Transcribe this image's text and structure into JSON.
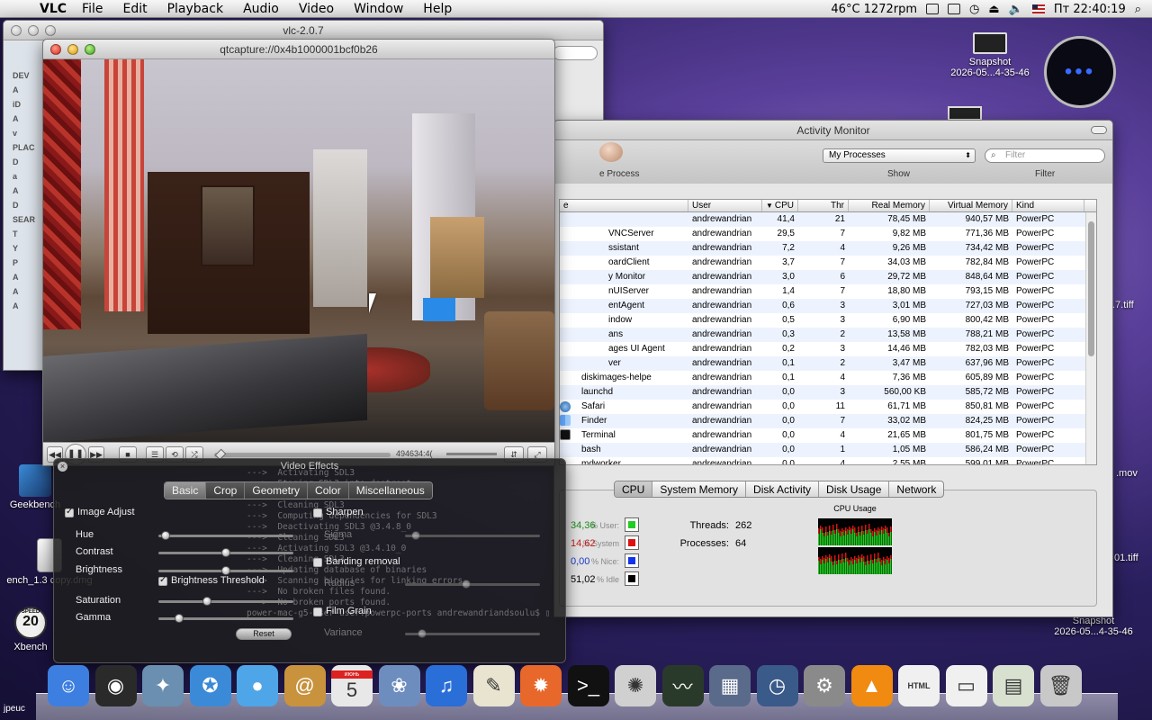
{
  "menubar": {
    "app": "VLC",
    "items": [
      "File",
      "Edit",
      "Playback",
      "Audio",
      "Video",
      "Window",
      "Help"
    ],
    "sensor": "46°C 1272rpm",
    "clock": "Пт 22:40:19"
  },
  "finder": {
    "title": "vlc-2.0.7",
    "sidebar": [
      "DEV",
      "A",
      "iD",
      "A",
      "v",
      "PLAC",
      "D",
      "a",
      "A",
      "D",
      "SEAR",
      "T",
      "Y",
      "P",
      "A",
      "A",
      "A"
    ]
  },
  "vlc": {
    "title": "qtcapture://0x4b1000001bcf0b26",
    "time": "494634:4("
  },
  "activity_monitor": {
    "title": "Activity Monitor",
    "process_label": "e Process",
    "filter_select": "My Processes",
    "search_placeholder": "Filter",
    "show_label": "Show",
    "filter_label": "Filter",
    "columns": [
      "e",
      "User",
      "CPU",
      "Thr",
      "Real Memory",
      "Virtual Memory",
      "Kind"
    ],
    "rows": [
      {
        "name": "",
        "user": "andrewandrian",
        "cpu": "41,4",
        "thr": "21",
        "rm": "78,45 MB",
        "vm": "940,57 MB",
        "kind": "PowerPC"
      },
      {
        "name": "VNCServer",
        "user": "andrewandrian",
        "cpu": "29,5",
        "thr": "7",
        "rm": "9,82 MB",
        "vm": "771,36 MB",
        "kind": "PowerPC"
      },
      {
        "name": "ssistant",
        "user": "andrewandrian",
        "cpu": "7,2",
        "thr": "4",
        "rm": "9,26 MB",
        "vm": "734,42 MB",
        "kind": "PowerPC"
      },
      {
        "name": "oardClient",
        "user": "andrewandrian",
        "cpu": "3,7",
        "thr": "7",
        "rm": "34,03 MB",
        "vm": "782,84 MB",
        "kind": "PowerPC"
      },
      {
        "name": "y Monitor",
        "user": "andrewandrian",
        "cpu": "3,0",
        "thr": "6",
        "rm": "29,72 MB",
        "vm": "848,64 MB",
        "kind": "PowerPC"
      },
      {
        "name": "nUIServer",
        "user": "andrewandrian",
        "cpu": "1,4",
        "thr": "7",
        "rm": "18,80 MB",
        "vm": "793,15 MB",
        "kind": "PowerPC"
      },
      {
        "name": "entAgent",
        "user": "andrewandrian",
        "cpu": "0,6",
        "thr": "3",
        "rm": "3,01 MB",
        "vm": "727,03 MB",
        "kind": "PowerPC"
      },
      {
        "name": "indow",
        "user": "andrewandrian",
        "cpu": "0,5",
        "thr": "3",
        "rm": "6,90 MB",
        "vm": "800,42 MB",
        "kind": "PowerPC"
      },
      {
        "name": "ans",
        "user": "andrewandrian",
        "cpu": "0,3",
        "thr": "2",
        "rm": "13,58 MB",
        "vm": "788,21 MB",
        "kind": "PowerPC"
      },
      {
        "name": "ages UI Agent",
        "user": "andrewandrian",
        "cpu": "0,2",
        "thr": "3",
        "rm": "14,46 MB",
        "vm": "782,03 MB",
        "kind": "PowerPC"
      },
      {
        "name": "ver",
        "user": "andrewandrian",
        "cpu": "0,1",
        "thr": "2",
        "rm": "3,47 MB",
        "vm": "637,96 MB",
        "kind": "PowerPC"
      },
      {
        "name": "diskimages-helpe",
        "user": "andrewandrian",
        "cpu": "0,1",
        "thr": "4",
        "rm": "7,36 MB",
        "vm": "605,89 MB",
        "kind": "PowerPC"
      },
      {
        "name": "launchd",
        "user": "andrewandrian",
        "cpu": "0,0",
        "thr": "3",
        "rm": "560,00 KB",
        "vm": "585,72 MB",
        "kind": "PowerPC"
      },
      {
        "name": "Safari",
        "user": "andrewandrian",
        "cpu": "0,0",
        "thr": "11",
        "rm": "61,71 MB",
        "vm": "850,81 MB",
        "kind": "PowerPC"
      },
      {
        "name": "Finder",
        "user": "andrewandrian",
        "cpu": "0,0",
        "thr": "7",
        "rm": "33,02 MB",
        "vm": "824,25 MB",
        "kind": "PowerPC"
      },
      {
        "name": "Terminal",
        "user": "andrewandrian",
        "cpu": "0,0",
        "thr": "4",
        "rm": "21,65 MB",
        "vm": "801,75 MB",
        "kind": "PowerPC"
      },
      {
        "name": "bash",
        "user": "andrewandrian",
        "cpu": "0,0",
        "thr": "1",
        "rm": "1,05 MB",
        "vm": "586,24 MB",
        "kind": "PowerPC"
      },
      {
        "name": "mdworker",
        "user": "andrewandrian",
        "cpu": "0,0",
        "thr": "4",
        "rm": "2,55 MB",
        "vm": "599,01 MB",
        "kind": "PowerPC"
      }
    ],
    "tabs": [
      "CPU",
      "System Memory",
      "Disk Activity",
      "Disk Usage",
      "Network"
    ],
    "cpu": {
      "user_label": "% User:",
      "user": "34,36",
      "system_label": "% System",
      "system": "14,62",
      "nice_label": "% Nice:",
      "nice": "0,00",
      "idle_label": "% Idle",
      "idle": "51,02",
      "threads_label": "Threads:",
      "threads": "262",
      "processes_label": "Processes:",
      "processes": "64",
      "graph_title": "CPU Usage"
    },
    "colors": {
      "user": "#22cc22",
      "system": "#dd1111",
      "nice": "#1133ee",
      "idle": "#000000"
    }
  },
  "video_effects": {
    "title": "Video Effects",
    "tabs": [
      "Basic",
      "Crop",
      "Geometry",
      "Color",
      "Miscellaneous"
    ],
    "image_adjust": "Image Adjust",
    "hue": "Hue",
    "contrast": "Contrast",
    "brightness": "Brightness",
    "brightness_threshold": "Brightness Threshold",
    "saturation": "Saturation",
    "gamma": "Gamma",
    "reset": "Reset",
    "sharpen": "Sharpen",
    "sigma": "Sigma",
    "banding": "Banding removal",
    "radius": "Radius",
    "film_grain": "Film Grain",
    "variance": "Variance",
    "levels": {
      "hue": 0.02,
      "contrast": 0.5,
      "brightness": 0.5,
      "saturation": 0.35,
      "gamma": 0.13,
      "sigma": 0.05,
      "radius": 0.45,
      "variance": 0.1
    }
  },
  "terminal_ghost": [
    "--->  Activating SDL3",
    "--->  Staging SDL3 into destroot",
    "--->  Installing SDL3 @3.4.10_0",
    "--->  Cleaning SDL3",
    "--->  Computing dependencies for SDL3",
    "--->  Deactivating SDL3 @3.4.8_0",
    "--->  Cleaning SDL3",
    "--->  Activating SDL3 @3.4.10_0",
    "--->  Cleaning SDL3",
    "--->  Updating database of binaries",
    "--->  Scanning binaries for linking errors",
    "--->  No broken files found.",
    "--->  No broken ports found.",
    "power-mac-g5-user-user:powerpc-ports andrewandriandsoulu$ ▯"
  ],
  "desktop": {
    "snapshot_top": "Snapshot",
    "snapshot_top_sub": "2026-05...4-35-46",
    "snapshot_bottom": "Snapshot",
    "snapshot_bottom_sub": "2026-05...4-35-46",
    "geekbench": "Geekbench",
    "dmg": "ench_1.3 copy.dmg",
    "xbench": "Xbench",
    "xbench_badge": "20",
    "xbench_top": "SPEED",
    "tiff": ".7.tiff",
    "mov": ".mov",
    "right_01": "01.tiff",
    "dock_tail": "jpeuc"
  },
  "dock": [
    {
      "name": "finder",
      "color": "#3d7fe0"
    },
    {
      "name": "dashboard",
      "color": "#2a2a2a"
    },
    {
      "name": "eagle",
      "color": "#6a8fb0"
    },
    {
      "name": "safari",
      "color": "#3b8ad8"
    },
    {
      "name": "ichat",
      "color": "#4ea6e8"
    },
    {
      "name": "address-book",
      "color": "#c9923d"
    },
    {
      "name": "ical",
      "color": "#e8e8e8"
    },
    {
      "name": "iphoto",
      "color": "#6d8dbf"
    },
    {
      "name": "itunes",
      "color": "#2a6ed8"
    },
    {
      "name": "textedit",
      "color": "#e8e4d0"
    },
    {
      "name": "firefox",
      "color": "#e8672a"
    },
    {
      "name": "terminal",
      "color": "#111111"
    },
    {
      "name": "pinwheel",
      "color": "#d0d0d0"
    },
    {
      "name": "activity-monitor",
      "color": "#2a3a2a"
    },
    {
      "name": "dashboard-widgets",
      "color": "#5a6a8a"
    },
    {
      "name": "time-machine",
      "color": "#3a5a8a"
    },
    {
      "name": "system-preferences",
      "color": "#8a8a8a"
    },
    {
      "name": "vlc",
      "color": "#f08a10"
    },
    {
      "name": "html-doc",
      "color": "#f0f0f0"
    },
    {
      "name": "disk-doc",
      "color": "#f0f0f0"
    },
    {
      "name": "preview-doc",
      "color": "#d8e0d0"
    },
    {
      "name": "trash",
      "color": "#c8c8c8"
    }
  ],
  "dock_glyphs": {
    "finder": "☺",
    "dashboard": "◉",
    "eagle": "✦",
    "safari": "✪",
    "ichat": "●",
    "address-book": "@",
    "ical": "5",
    "iphoto": "❀",
    "itunes": "♫",
    "textedit": "✎",
    "firefox": "✹",
    "terminal": ">_",
    "pinwheel": "✺",
    "activity-monitor": "〰",
    "dashboard-widgets": "▦",
    "time-machine": "◷",
    "system-preferences": "⚙",
    "vlc": "▲",
    "html-doc": "HTML",
    "disk-doc": "▭",
    "preview-doc": "▤",
    "trash": "🗑"
  },
  "ical_month": "июнь"
}
